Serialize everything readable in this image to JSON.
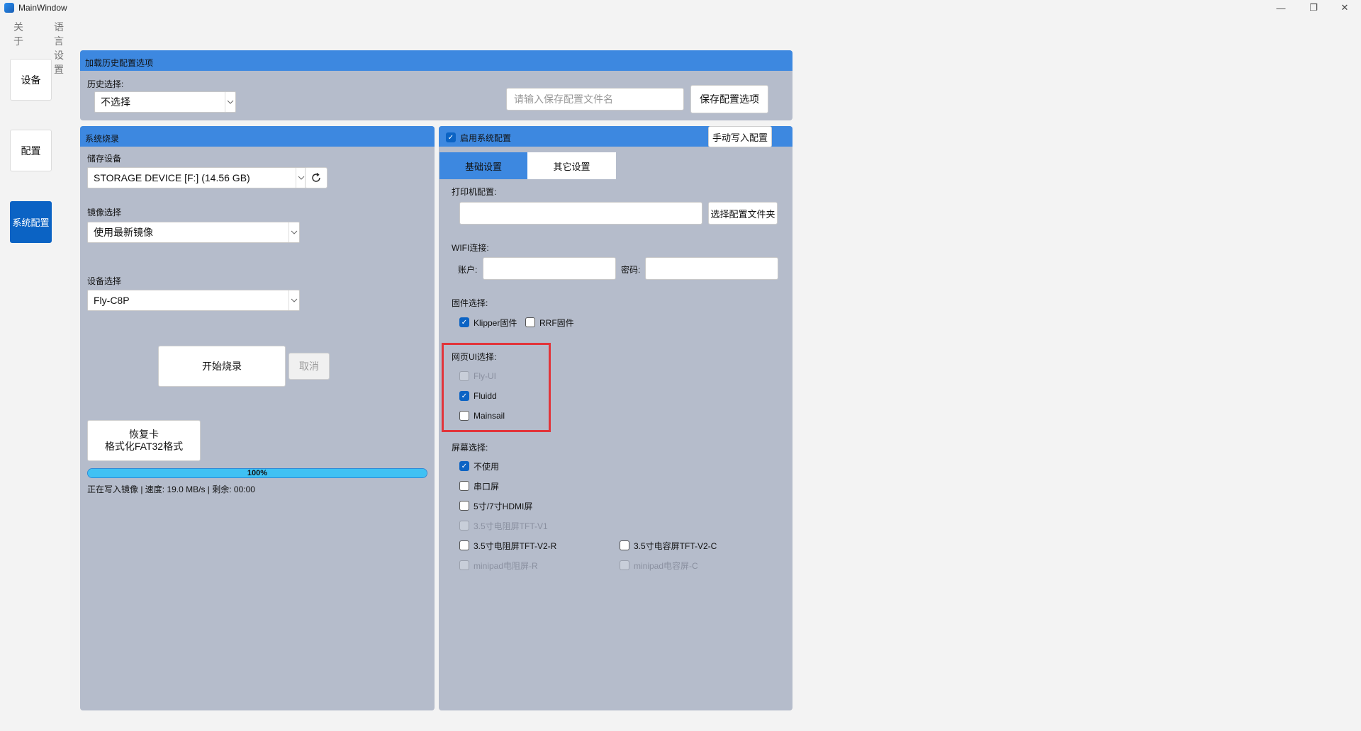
{
  "window": {
    "title": "MainWindow",
    "minimize": "—",
    "maximize": "❐",
    "close": "✕"
  },
  "menu": {
    "about": "关于",
    "language": "语言设置"
  },
  "nav": {
    "device": "设备",
    "config": "配置",
    "system_config": "系统配置"
  },
  "history": {
    "header": "加载历史配置选项",
    "select_label": "历史选择:",
    "select_value": "不选择",
    "filename_placeholder": "请输入保存配置文件名",
    "save_button": "保存配置选项"
  },
  "burn": {
    "header": "系统烧录",
    "storage_label": "储存设备",
    "storage_value": "STORAGE DEVICE [F:] (14.56 GB)",
    "image_label": "镜像选择",
    "image_value": "使用最新镜像",
    "device_label": "设备选择",
    "device_value": "Fly-C8P",
    "start_button": "开始烧录",
    "cancel_button": "取消",
    "restore_line1": "恢复卡",
    "restore_line2": "格式化FAT32格式",
    "progress": 100,
    "progress_text": "100%",
    "status_text": "正在写入镜像 | 速度: 19.0 MB/s | 剩余: 00:00"
  },
  "sysconfig": {
    "enable_label": "启用系统配置",
    "manual_write_button": "手动写入配置",
    "tabs": [
      "基础设置",
      "其它设置"
    ],
    "printer_label": "打印机配置:",
    "select_folder_button": "选择配置文件夹",
    "wifi_label": "WIFI连接:",
    "account_label": "账户:",
    "password_label": "密码:",
    "firmware_label": "固件选择:",
    "firmware": [
      {
        "label": "Klipper固件",
        "checked": true
      },
      {
        "label": "RRF固件",
        "checked": false
      }
    ],
    "webui_label": "网页UI选择:",
    "webui": [
      {
        "label": "Fly-UI",
        "checked": false,
        "disabled": true
      },
      {
        "label": "Fluidd",
        "checked": true
      },
      {
        "label": "Mainsail",
        "checked": false
      }
    ],
    "screen_label": "屏幕选择:",
    "screens": [
      {
        "label": "不使用",
        "checked": true
      },
      {
        "label": "串口屏",
        "checked": false
      },
      {
        "label": "5寸/7寸HDMI屏",
        "checked": false
      },
      {
        "label": "3.5寸电阻屏TFT-V1",
        "checked": false,
        "disabled": true
      },
      {
        "label": "3.5寸电阻屏TFT-V2-R",
        "checked": false
      },
      {
        "label": "3.5寸电容屏TFT-V2-C",
        "checked": false
      },
      {
        "label": "minipad电阻屏-R",
        "checked": false,
        "disabled": true
      },
      {
        "label": "minipad电容屏-C",
        "checked": false,
        "disabled": true
      }
    ]
  },
  "icons": {
    "refresh": "refresh-icon",
    "check": "check-icon",
    "arrow": "chevron-down-icon"
  },
  "colors": {
    "accent": "#0b63c4",
    "header": "#3d88e0",
    "panel": "#b5bccb",
    "highlight": "#e2343a",
    "progress": "#3fc1f3"
  }
}
